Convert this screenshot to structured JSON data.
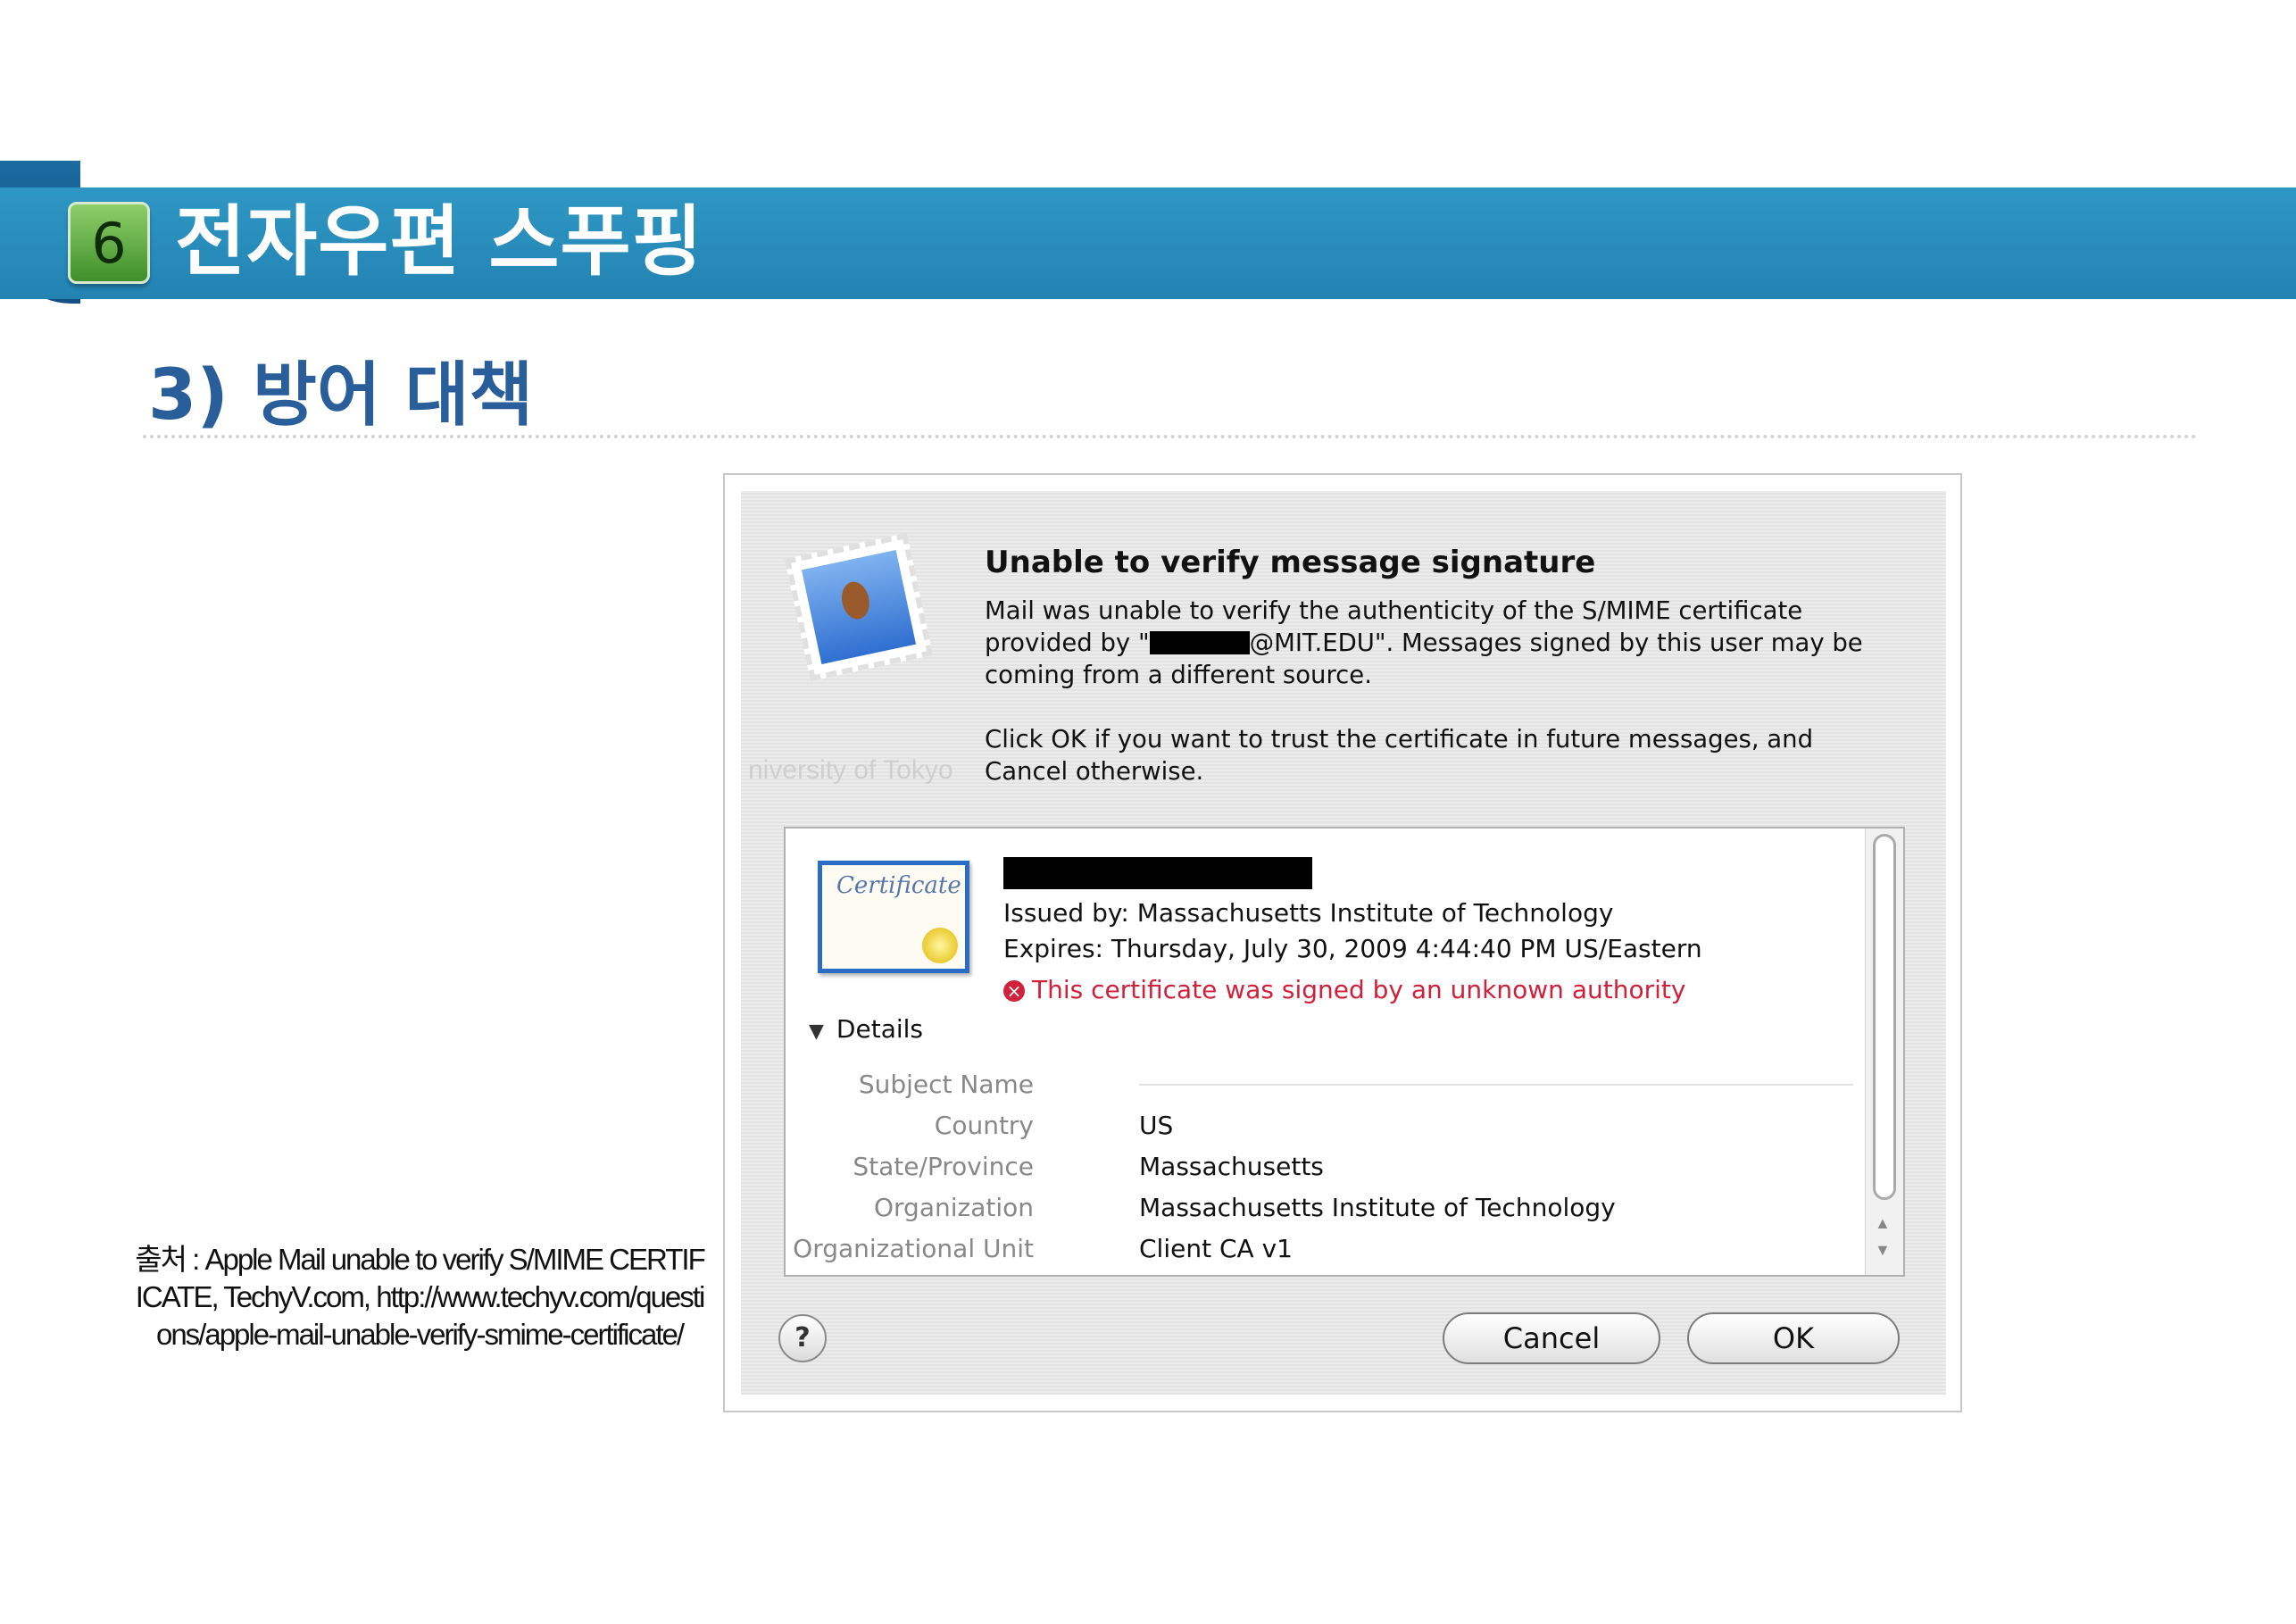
{
  "slide": {
    "section_number": "6",
    "title": "전자우편 스푸핑",
    "subtitle": "3) 방어 대책",
    "caption": "출처 : Apple Mail unable to verify S/MIME CERTIFICATE, TechyV.com, http://www.techyv.com/questions/apple-mail-unable-verify-smime-certificate/"
  },
  "dialog": {
    "heading": "Unable to verify message signature",
    "message_line1": "Mail was unable to verify the authenticity of the S/MIME certificate",
    "message_line2_prefix": "provided by \"",
    "message_line2_suffix": "@MIT.EDU\". Messages signed by this user may be",
    "message_line3": "coming from a different source.",
    "instruction_line1": "Click OK if you want to trust the certificate in future messages, and",
    "instruction_line2": "Cancel otherwise.",
    "background_text": "niversity of Tokyo",
    "icon": "mail-stamp-icon",
    "certificate": {
      "icon_text": "Certificate",
      "issued_by": "Issued by: Massachusetts Institute of Technology",
      "expires": "Expires: Thursday, July 30, 2009 4:44:40 PM US/Eastern",
      "warning_icon": "error-x-icon",
      "warning": "This certificate was signed by an unknown authority",
      "details_label": "Details",
      "subject_heading": "Subject Name",
      "fields": [
        {
          "label": "Country",
          "value": "US"
        },
        {
          "label": "State/Province",
          "value": "Massachusetts"
        },
        {
          "label": "Organization",
          "value": "Massachusetts Institute of Technology"
        },
        {
          "label": "Organizational Unit",
          "value": "Client CA v1"
        }
      ]
    },
    "buttons": {
      "help": "?",
      "cancel": "Cancel",
      "ok": "OK"
    }
  },
  "colors": {
    "banner": "#2a8dbf",
    "subtitle": "#2a5e9b",
    "warning": "#d0203a"
  }
}
